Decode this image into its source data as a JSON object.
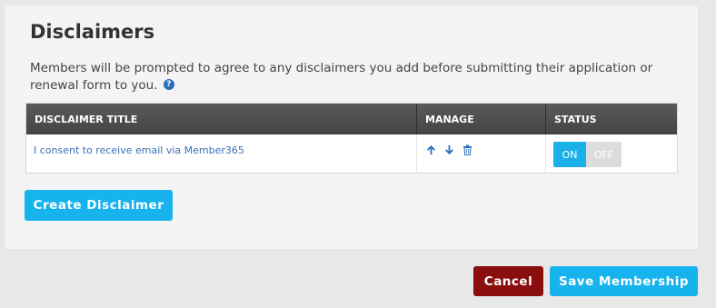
{
  "panel": {
    "title": "Disclaimers",
    "description": "Members will be prompted to agree to any disclaimers you add before submitting their application or renewal form to you.",
    "help_icon": "question-circle-icon"
  },
  "table": {
    "columns": [
      "DISCLAIMER TITLE",
      "MANAGE",
      "STATUS"
    ],
    "rows": [
      {
        "title": "I consent to receive email via Member365",
        "manage_icons": [
          "arrow-up-icon",
          "arrow-down-icon",
          "trash-icon"
        ],
        "status_on_label": "ON",
        "status_off_label": "OFF",
        "status_value": "ON"
      }
    ]
  },
  "actions": {
    "create_label": "Create Disclaimer",
    "cancel_label": "Cancel",
    "save_label": "Save Membership"
  },
  "colors": {
    "accent": "#16b3ee",
    "danger": "#8b0e0e",
    "link": "#3a6fb7",
    "header_bg": "#4a4a4a"
  }
}
